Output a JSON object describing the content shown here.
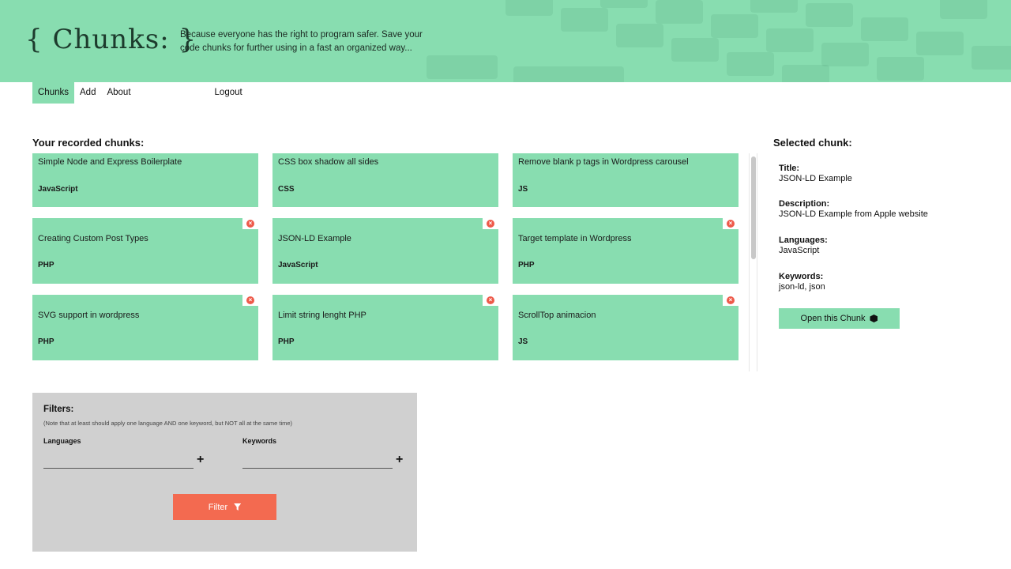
{
  "header": {
    "logo": "{ Chunks: }",
    "tagline": "Because everyone has the right to program safer. Save your code chunks for further using in a fast an organized way...",
    "bg_color": "#88ddb0"
  },
  "nav": {
    "items": [
      {
        "label": "Chunks",
        "active": true
      },
      {
        "label": "Add",
        "active": false
      },
      {
        "label": "About",
        "active": false
      }
    ],
    "logout": "Logout"
  },
  "main": {
    "title": "Your recorded chunks:",
    "chunks": [
      {
        "title": "Simple Node and Express Boilerplate",
        "language": "JavaScript",
        "deletable": false
      },
      {
        "title": "CSS box shadow all sides",
        "language": "CSS",
        "deletable": false
      },
      {
        "title": "Remove blank p tags in Wordpress carousel",
        "language": "JS",
        "deletable": false
      },
      {
        "title": "Creating Custom Post Types",
        "language": "PHP",
        "deletable": true
      },
      {
        "title": "JSON-LD Example",
        "language": "JavaScript",
        "deletable": true
      },
      {
        "title": "Target template in Wordpress",
        "language": "PHP",
        "deletable": true
      },
      {
        "title": "SVG support in wordpress",
        "language": "PHP",
        "deletable": true
      },
      {
        "title": "Limit string lenght PHP",
        "language": "PHP",
        "deletable": true
      },
      {
        "title": "ScrollTop animacion",
        "language": "JS",
        "deletable": true
      }
    ]
  },
  "selected": {
    "heading": "Selected chunk:",
    "title_label": "Title:",
    "title": "JSON-LD Example",
    "description_label": "Description:",
    "description": "JSON-LD Example from Apple website",
    "languages_label": "Languages:",
    "languages": "JavaScript",
    "keywords_label": "Keywords:",
    "keywords": "json-ld, json",
    "open_button": "Open this Chunk",
    "open_icon": "cube-icon"
  },
  "filters": {
    "title": "Filters:",
    "note": "(Note that at least should apply one language AND one keyword, but NOT all at the same time)",
    "languages_label": "Languages",
    "keywords_label": "Keywords",
    "languages_value": "",
    "keywords_value": "",
    "add_icon": "plus-icon",
    "button": "Filter",
    "button_icon": "funnel-icon",
    "button_color": "#f36a50"
  }
}
